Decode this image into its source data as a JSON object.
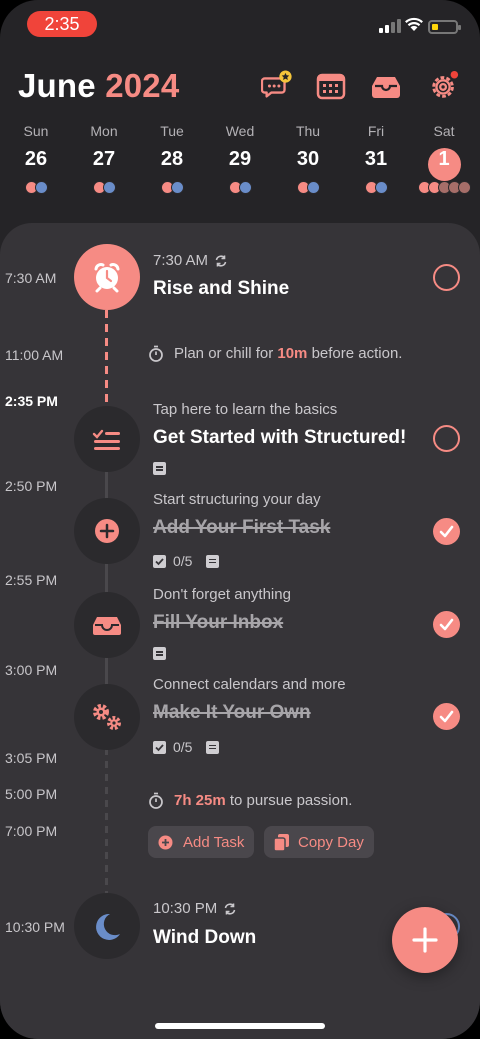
{
  "status": {
    "time": "2:35"
  },
  "header": {
    "month": "June",
    "year": "2024"
  },
  "week": [
    {
      "name": "Sun",
      "date": "26"
    },
    {
      "name": "Mon",
      "date": "27"
    },
    {
      "name": "Tue",
      "date": "28"
    },
    {
      "name": "Wed",
      "date": "29"
    },
    {
      "name": "Thu",
      "date": "30"
    },
    {
      "name": "Fri",
      "date": "31"
    },
    {
      "name": "Sat",
      "date": "1"
    }
  ],
  "timeline": {
    "times": [
      "7:30 AM",
      "11:00 AM",
      "2:35 PM",
      "2:50 PM",
      "2:55 PM",
      "3:00 PM",
      "3:05 PM",
      "5:00 PM",
      "7:00 PM",
      "10:30 PM"
    ],
    "rise": {
      "sub": "7:30 AM",
      "title": "Rise and Shine"
    },
    "gap1": {
      "pre": "Plan or chill for ",
      "value": "10m",
      "post": " before action."
    },
    "started": {
      "sub": "Tap here to learn the basics",
      "title": "Get Started with Structured!"
    },
    "first": {
      "sub": "Start structuring your day",
      "title": "Add Your First Task",
      "count": "0/5"
    },
    "inbox": {
      "sub": "Don't forget anything",
      "title": "Fill Your Inbox"
    },
    "own": {
      "sub": "Connect calendars and more",
      "title": "Make It Your Own",
      "count": "0/5"
    },
    "gap2": {
      "value": "7h 25m",
      "post": " to pursue passion."
    },
    "add_task": "Add Task",
    "copy_day": "Copy Day",
    "wind": {
      "sub": "10:30 PM",
      "title": "Wind Down"
    }
  },
  "colors": {
    "accent": "#f68b84",
    "background": "#252427",
    "sheet": "#363438",
    "red_pill": "#f0443a"
  },
  "icons": [
    "chat-star-icon",
    "calendar-icon",
    "inbox-icon",
    "settings-icon",
    "alarm-icon",
    "checklist-icon",
    "plus-icon",
    "inbox-tray-icon",
    "gears-icon",
    "moon-icon",
    "stopwatch-icon",
    "repeat-icon"
  ]
}
